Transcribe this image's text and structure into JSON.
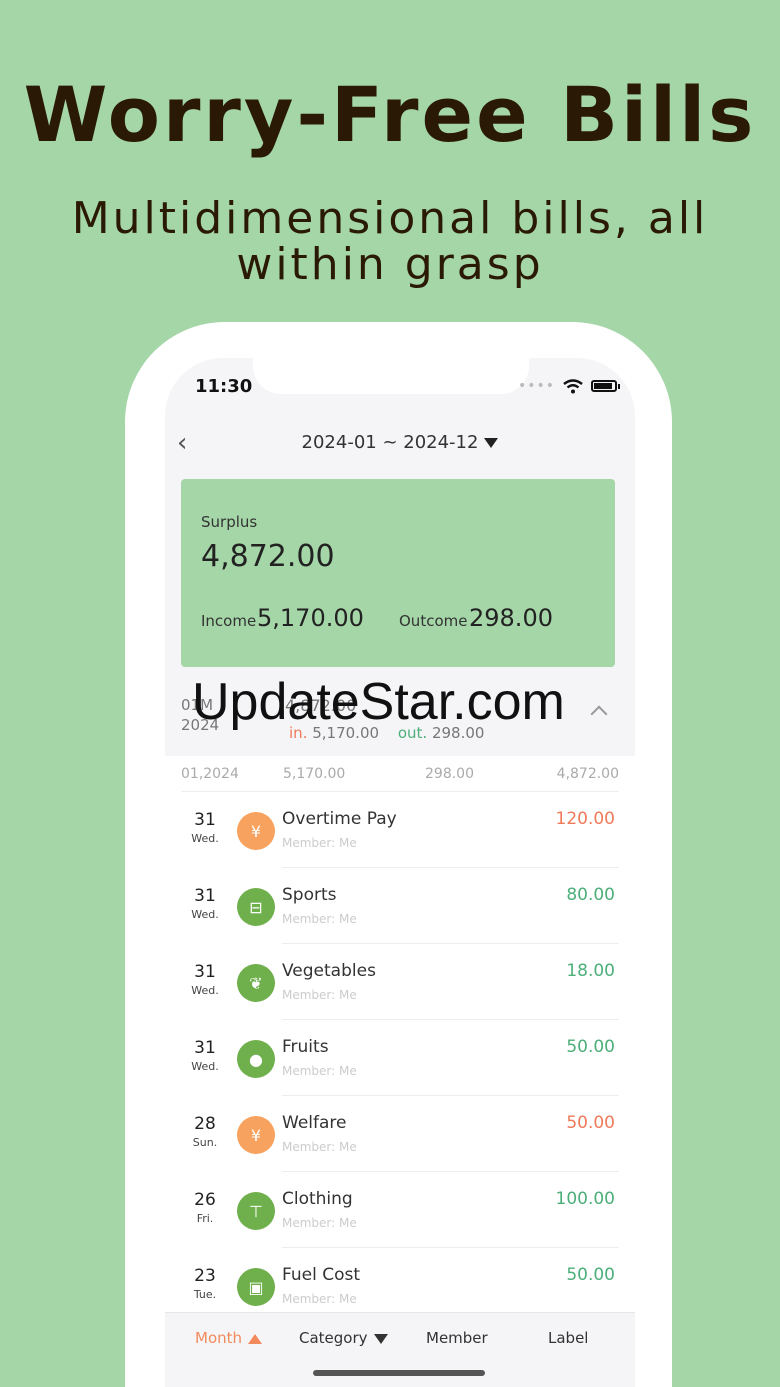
{
  "promo": {
    "headline": "Worry-Free Bills",
    "subline": "Multidimensional bills, all within grasp"
  },
  "status_bar": {
    "time": "11:30",
    "icons": [
      "signal-dots-icon",
      "wifi-icon",
      "battery-icon"
    ]
  },
  "nav": {
    "back_icon": "chevron-left-icon",
    "title": "2024-01 ~ 2024-12"
  },
  "summary": {
    "surplus_label": "Surplus",
    "surplus_value": "4,872.00",
    "income_label": "Income",
    "income_value": "5,170.00",
    "outcome_label": "Outcome",
    "outcome_value": "298.00"
  },
  "month_block": {
    "month": "01M",
    "year": "2024",
    "total": "4,872.00",
    "in_label": "in.",
    "in_value": "5,170.00",
    "out_label": "out.",
    "out_value": "298.00"
  },
  "watermark": "UpdateStar.com",
  "list_header": {
    "date": "01,2024",
    "income": "5,170.00",
    "outcome": "298.00",
    "surplus": "4,872.00"
  },
  "rows": [
    {
      "day": "31",
      "weekday": "Wed.",
      "name": "Overtime Pay",
      "member": "Member: Me",
      "amount": "120.00",
      "kind": "income",
      "icon": "money-bag-icon"
    },
    {
      "day": "31",
      "weekday": "Wed.",
      "name": "Sports",
      "member": "Member: Me",
      "amount": "80.00",
      "kind": "expense",
      "icon": "dumbbell-icon"
    },
    {
      "day": "31",
      "weekday": "Wed.",
      "name": "Vegetables",
      "member": "Member: Me",
      "amount": "18.00",
      "kind": "expense",
      "icon": "leaf-icon"
    },
    {
      "day": "31",
      "weekday": "Wed.",
      "name": "Fruits",
      "member": "Member: Me",
      "amount": "50.00",
      "kind": "expense",
      "icon": "apple-icon"
    },
    {
      "day": "28",
      "weekday": "Sun.",
      "name": "Welfare",
      "member": "Member: Me",
      "amount": "50.00",
      "kind": "income",
      "icon": "money-bag-icon"
    },
    {
      "day": "26",
      "weekday": "Fri.",
      "name": "Clothing",
      "member": "Member: Me",
      "amount": "100.00",
      "kind": "expense",
      "icon": "shirt-icon"
    },
    {
      "day": "23",
      "weekday": "Tue.",
      "name": "Fuel Cost",
      "member": "Member: Me",
      "amount": "50.00",
      "kind": "expense",
      "icon": "fuel-pump-icon"
    }
  ],
  "tabs": {
    "month": "Month",
    "category": "Category",
    "member": "Member",
    "label": "Label"
  },
  "colors": {
    "background": "#a5d6a7",
    "income": "#ef7a5a",
    "expense": "#4caf7a",
    "active_tab": "#f28a5c"
  }
}
